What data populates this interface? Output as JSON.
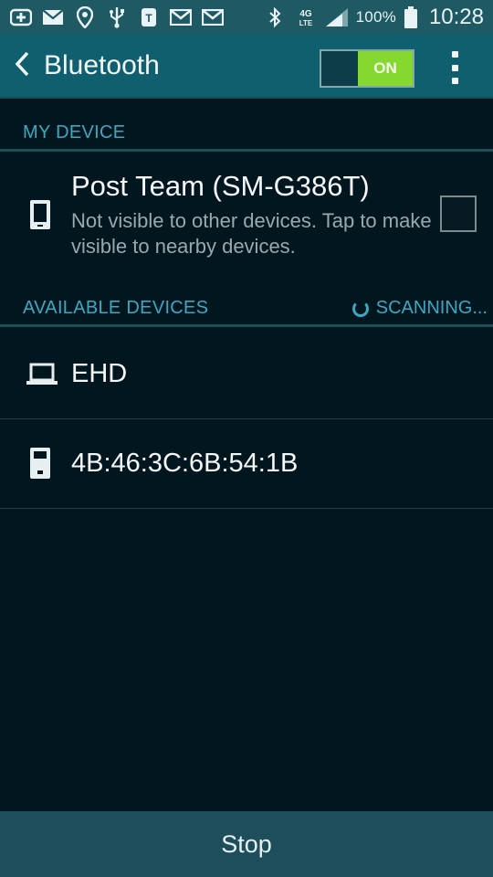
{
  "status_bar": {
    "icons": [
      "add-icon",
      "email-icon",
      "location-icon",
      "usb-icon",
      "tmobile-icon",
      "gmail-icon",
      "gmail-icon",
      "bluetooth-icon",
      "4g-lte-icon",
      "signal-icon"
    ],
    "battery_text": "100%",
    "time": "10:28"
  },
  "action_bar": {
    "title": "Bluetooth",
    "toggle_label": "ON"
  },
  "my_device_section": {
    "header": "MY DEVICE",
    "device": {
      "name": "Post Team (SM-G386T)",
      "subtitle": "Not visible to other devices. Tap to make visible to nearby devices."
    }
  },
  "available_section": {
    "header": "AVAILABLE DEVICES",
    "scanning_label": "SCANNING..."
  },
  "devices": [
    {
      "name": "EHD",
      "icon": "laptop-icon"
    },
    {
      "name": "4B:46:3C:6B:54:1B",
      "icon": "device-icon"
    }
  ],
  "bottom": {
    "stop_label": "Stop"
  },
  "colors": {
    "background": "#02161f",
    "action_bar": "#0f5f6e",
    "accent": "#3aa9c1",
    "toggle_on": "#84d82f",
    "bottom_bar": "#1e4e5b"
  }
}
